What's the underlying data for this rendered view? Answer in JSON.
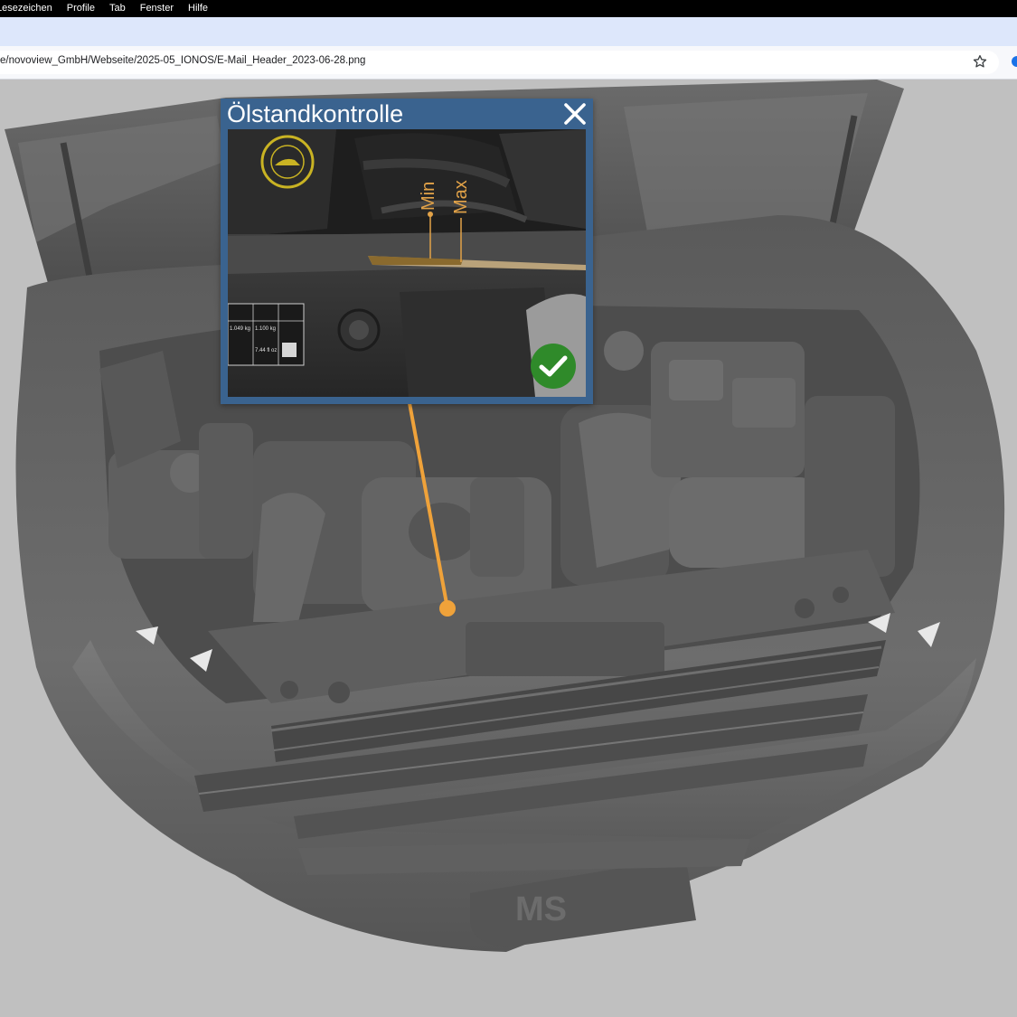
{
  "menubar": {
    "items": [
      "Lesezeichen",
      "Profile",
      "Tab",
      "Fenster",
      "Hilfe"
    ]
  },
  "toolbar": {
    "address": "e/novoview_GmbH/Webseite/2025-05_IONOS/E-Mail_Header_2023-06-28.png",
    "bookmark_icon": "star-outline-icon"
  },
  "popup": {
    "title": "Ölstandkontrolle",
    "close_icon": "close-x-icon",
    "status_icon": "checkmark-circle-icon",
    "dipstick_labels": {
      "min": "Min",
      "max": "Max"
    },
    "sticker": {
      "cells": [
        "1.049 kg",
        "1.100 kg",
        "7.44 fl oz"
      ]
    }
  },
  "scene": {
    "plate_text": "MS"
  },
  "colors": {
    "popup_frame": "#3a638f",
    "pointer_line": "#efa23a",
    "check_badge": "#2f8a2a",
    "viewport_bg": "#c0c0c0"
  }
}
